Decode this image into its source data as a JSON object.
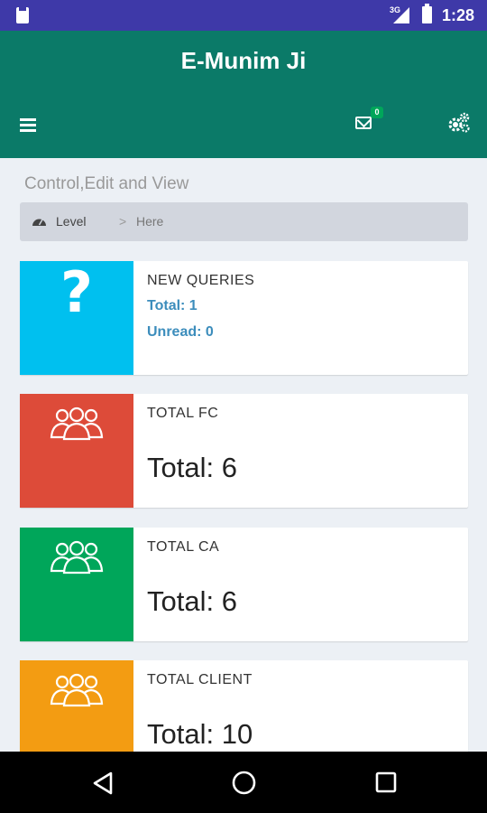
{
  "status_bar": {
    "network": "3G",
    "time": "1:28"
  },
  "header": {
    "title": "E-Munim Ji",
    "notification_count": "0"
  },
  "subtitle": "Control,Edit and View",
  "breadcrumb": {
    "level": "Level",
    "separator": ">",
    "current": "Here"
  },
  "cards": [
    {
      "label": "NEW QUERIES",
      "color": "#00c0ef",
      "icon": "question-icon",
      "line1": "Total: 1",
      "line2": "Unread: 0"
    },
    {
      "label": "TOTAL FC",
      "color": "#dd4b39",
      "icon": "users-icon",
      "value": "Total: 6"
    },
    {
      "label": "TOTAL CA",
      "color": "#00a65a",
      "icon": "users-icon",
      "value": "Total: 6"
    },
    {
      "label": "TOTAL CLIENT",
      "color": "#f39c12",
      "icon": "users-icon",
      "value": "Total: 10"
    }
  ],
  "colors": {
    "status_bar": "#3e39a8",
    "header": "#0b7a68",
    "background": "#ecf0f5"
  }
}
